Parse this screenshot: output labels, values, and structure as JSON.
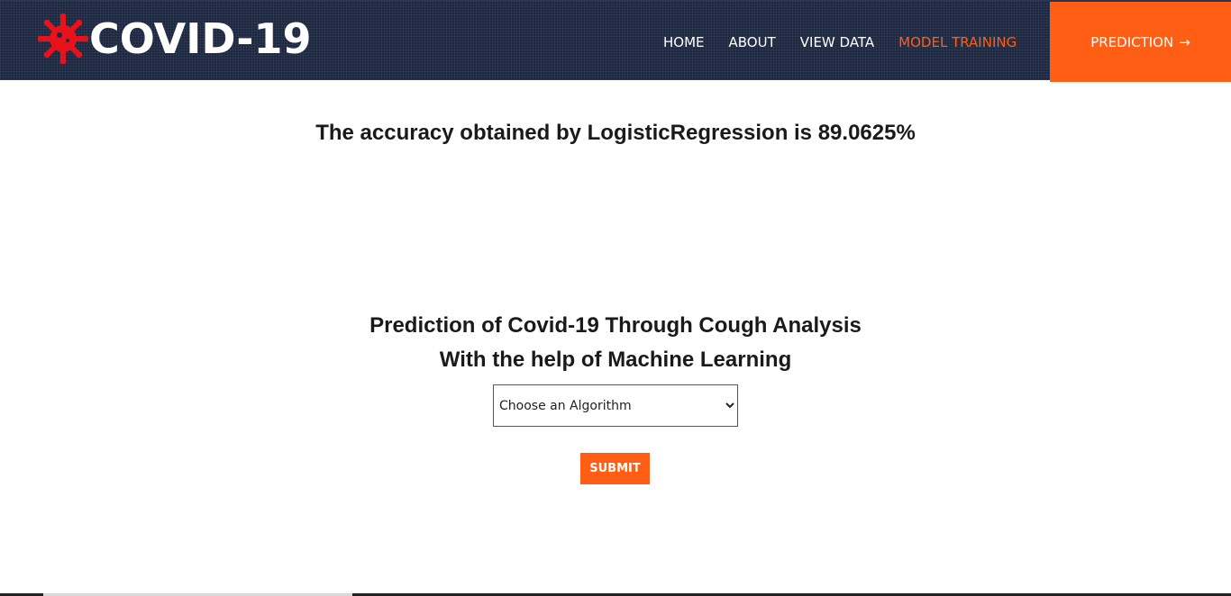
{
  "header": {
    "logo_text": "COVID-19",
    "logo_icon": "virus-icon",
    "nav": [
      {
        "label": "HOME",
        "active": false
      },
      {
        "label": "ABOUT",
        "active": false
      },
      {
        "label": "VIEW DATA",
        "active": false
      },
      {
        "label": "MODEL TRAINING",
        "active": true
      }
    ],
    "prediction_label": "PREDICTION",
    "prediction_icon": "arrow-right-icon",
    "prediction_arrow": "→"
  },
  "main": {
    "accuracy_text": "The accuracy obtained by LogisticRegression is 89.0625%",
    "title_line1": "Prediction of Covid-19 Through Cough Analysis",
    "title_line2": "With the help of Machine Learning",
    "algorithm_select": {
      "selected": "Choose an Algorithm"
    },
    "submit_label": "SUBMIT"
  },
  "colors": {
    "header_bg": "#1c2740",
    "accent": "#ff5e14",
    "text": "#1a1a1a"
  }
}
